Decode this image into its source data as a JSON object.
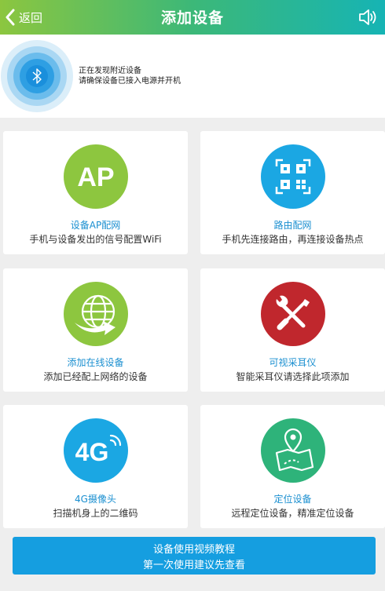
{
  "header": {
    "back_label": "返回",
    "title": "添加设备",
    "back_icon": "chevron-left-icon",
    "speaker_icon": "speaker-icon"
  },
  "discover": {
    "line1": "正在发现附近设备",
    "line2": "请确保设备已接入电源并开机",
    "icon": "bluetooth-icon"
  },
  "cards": [
    {
      "title": "设备AP配网",
      "desc": "手机与设备发出的信号配置WiFi",
      "icon": "ap-icon",
      "icon_text": "AP",
      "color": "#8dc63f"
    },
    {
      "title": "路由配网",
      "desc": "手机先连接路由，再连接设备热点",
      "icon": "qr-code-icon",
      "color": "#1ba7e3"
    },
    {
      "title": "添加在线设备",
      "desc": "添加已经配上网络的设备",
      "icon": "globe-icon",
      "color": "#8dc63f"
    },
    {
      "title": "可视采耳仪",
      "desc": "智能采耳仪请选择此项添加",
      "icon": "tools-icon",
      "color": "#c0272d"
    },
    {
      "title": "4G摄像头",
      "desc": "扫描机身上的二维码",
      "icon": "4g-icon",
      "icon_text": "4G",
      "color": "#1ba7e3"
    },
    {
      "title": "定位设备",
      "desc": "远程定位设备，精准定位设备",
      "icon": "map-pin-icon",
      "color": "#2eb37a"
    }
  ],
  "tutorial": {
    "line1": "设备使用视频教程",
    "line2": "第一次使用建议先查看",
    "color": "#159ee0"
  }
}
